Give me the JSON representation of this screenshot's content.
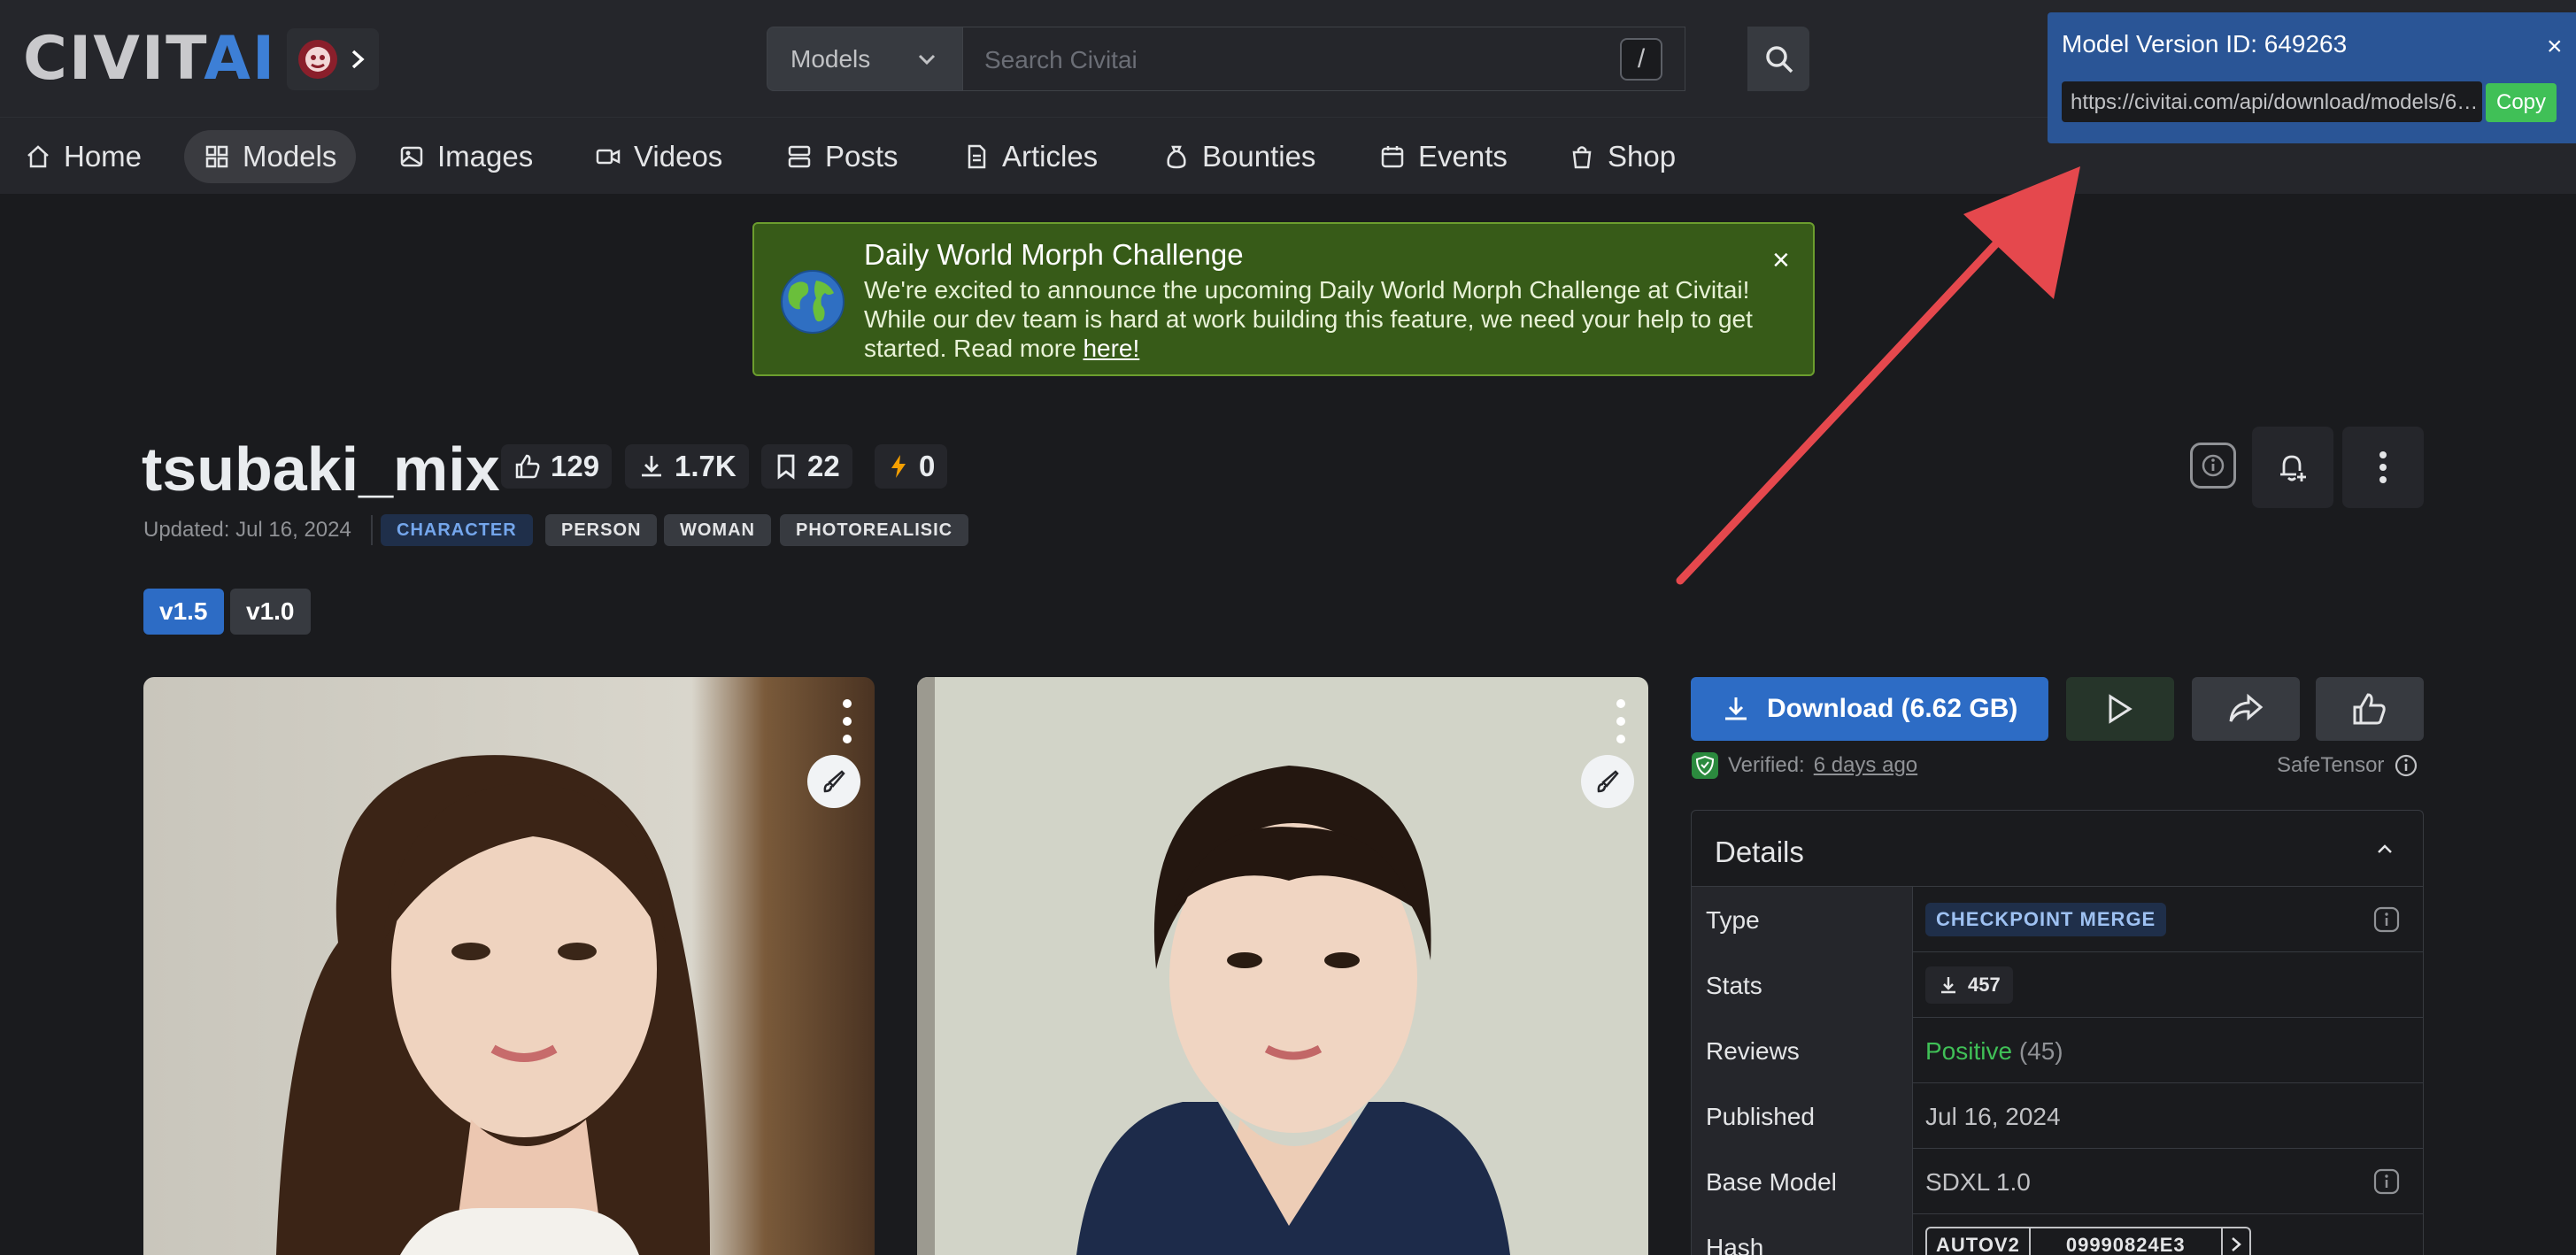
{
  "header": {
    "logo": {
      "part1": "CIVIT",
      "part2": "AI"
    },
    "search": {
      "category": "Models",
      "placeholder": "Search Civitai",
      "shortcut": "/"
    }
  },
  "nav": {
    "items": [
      {
        "label": "Home",
        "icon": "home-icon"
      },
      {
        "label": "Models",
        "icon": "grid-icon",
        "active": true
      },
      {
        "label": "Images",
        "icon": "image-icon"
      },
      {
        "label": "Videos",
        "icon": "video-icon"
      },
      {
        "label": "Posts",
        "icon": "posts-icon"
      },
      {
        "label": "Articles",
        "icon": "article-icon"
      },
      {
        "label": "Bounties",
        "icon": "moneybag-icon"
      },
      {
        "label": "Events",
        "icon": "calendar-icon"
      },
      {
        "label": "Shop",
        "icon": "shopping-bag-icon"
      }
    ]
  },
  "popup": {
    "title": "Model Version ID: 649263",
    "url": "https://civitai.com/api/download/models/649263",
    "copy_label": "Copy",
    "close": "×"
  },
  "banner": {
    "title": "Daily World Morph Challenge",
    "body": "We're excited to announce the upcoming Daily World Morph Challenge at Civitai! While our dev team is hard at work building this feature, we need your help to get started. Read more ",
    "link": "here!",
    "close": "×"
  },
  "model": {
    "title": "tsubaki_mix",
    "stats": {
      "likes": "129",
      "downloads": "1.7K",
      "bookmarks": "22",
      "buzz": "0"
    },
    "updated": "Updated: Jul 16, 2024",
    "tags": [
      "CHARACTER",
      "PERSON",
      "WOMAN",
      "PHOTOREALISIC"
    ],
    "versions": [
      "v1.5",
      "v1.0"
    ]
  },
  "panel": {
    "download_label": "Download (6.62 GB)",
    "verified_label": "Verified:",
    "verified_when": "6 days ago",
    "safetensor": "SafeTensor",
    "details_title": "Details",
    "rows": {
      "type_label": "Type",
      "type_value": "CHECKPOINT MERGE",
      "stats_label": "Stats",
      "stats_value": "457",
      "reviews_label": "Reviews",
      "reviews_value": "Positive",
      "reviews_count": "(45)",
      "published_label": "Published",
      "published_value": "Jul 16, 2024",
      "base_label": "Base Model",
      "base_value": "SDXL 1.0",
      "hash_label": "Hash",
      "hash_type": "AUTOV2",
      "hash_value": "09990824E3"
    }
  },
  "colors": {
    "accent": "#2d6cc5",
    "banner": "#375b18",
    "positive": "#40c057"
  }
}
